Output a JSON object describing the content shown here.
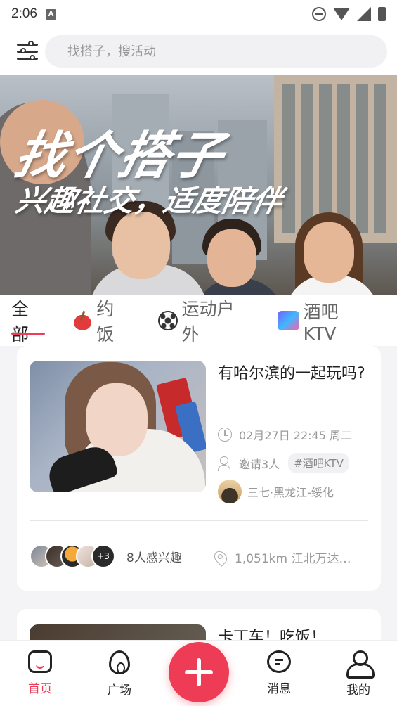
{
  "status_bar": {
    "time": "2:06",
    "notification_letter": "A"
  },
  "search": {
    "placeholder": "找搭子，搜活动"
  },
  "banner": {
    "title": "找个搭子",
    "subtitle": "兴趣社交，适度陪伴"
  },
  "tabs": [
    {
      "label": "全部",
      "icon": "",
      "active": true
    },
    {
      "label": "约饭",
      "icon": "bowl-icon",
      "active": false
    },
    {
      "label": "运动户外",
      "icon": "soccer-ball-icon",
      "active": false
    },
    {
      "label": "酒吧KTV",
      "icon": "ktv-icon",
      "active": false
    }
  ],
  "cards": [
    {
      "title": "有哈尔滨的一起玩吗?",
      "datetime": "02月27日 22:45 周二",
      "invite": "邀请3人",
      "tag": "#酒吧KTV",
      "user": "三七·黑龙江-绥化",
      "avatar_overflow": "+3",
      "interest": "8人感兴趣",
      "location": "1,051km 江北万达…"
    },
    {
      "title": "卡丁车！吃饭！"
    }
  ],
  "nav": {
    "home": "首页",
    "plaza": "广场",
    "messages": "消息",
    "mine": "我的"
  },
  "colors": {
    "accent": "#ee3b56",
    "background": "#f4f4f6"
  }
}
